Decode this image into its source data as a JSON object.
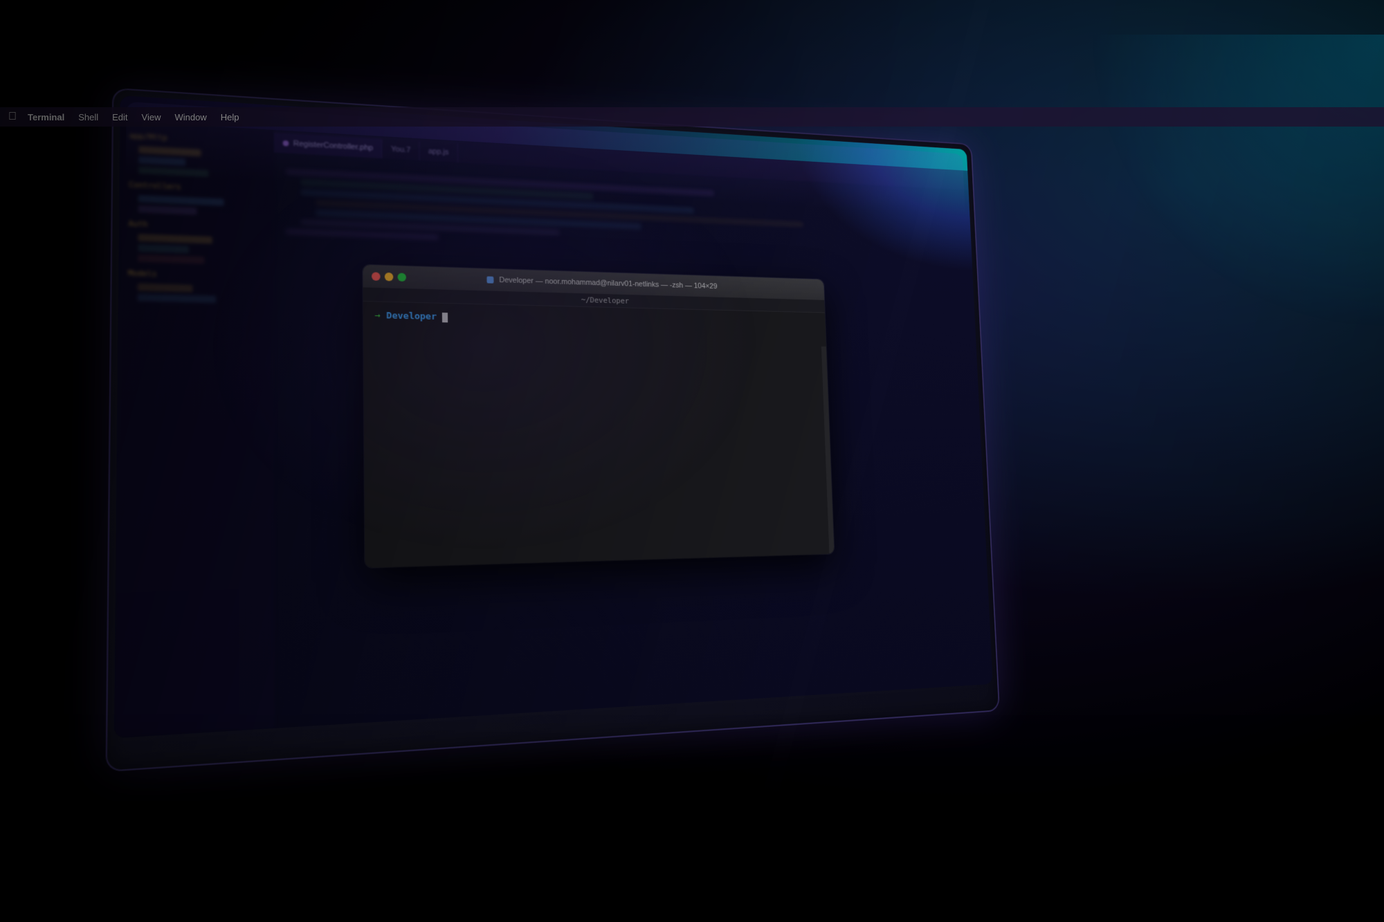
{
  "scene": {
    "background_color": "#000000"
  },
  "menubar": {
    "apple_symbol": "",
    "items": [
      {
        "label": "Terminal",
        "active": true
      },
      {
        "label": "Shell",
        "active": false
      },
      {
        "label": "Edit",
        "active": false
      },
      {
        "label": "View",
        "active": false
      },
      {
        "label": "Window",
        "active": false
      },
      {
        "label": "Help",
        "active": false
      }
    ]
  },
  "terminal": {
    "title": "Developer — noor.mohammad@nilarv01-netlinks — -zsh — 104×29",
    "path_label": "~/Developer",
    "dimensions": "104×29",
    "traffic_lights": {
      "close_color": "#ff5f57",
      "minimize_color": "#ffbd2e",
      "maximize_color": "#28c940"
    },
    "prompt": {
      "arrow": "→",
      "directory": "Developer",
      "cursor": ""
    }
  },
  "editor": {
    "tabs": [
      {
        "label": "RegisterController.php",
        "color": "#b57bff",
        "active": true
      },
      {
        "label": "You.7",
        "color": "#888",
        "active": false
      },
      {
        "label": "app.js",
        "color": "#f0a830",
        "active": false
      }
    ]
  },
  "ambient": {
    "glow_color_right": "rgba(0, 160, 200, 0.3)",
    "glow_color_center": "rgba(60, 40, 120, 0.2)"
  }
}
